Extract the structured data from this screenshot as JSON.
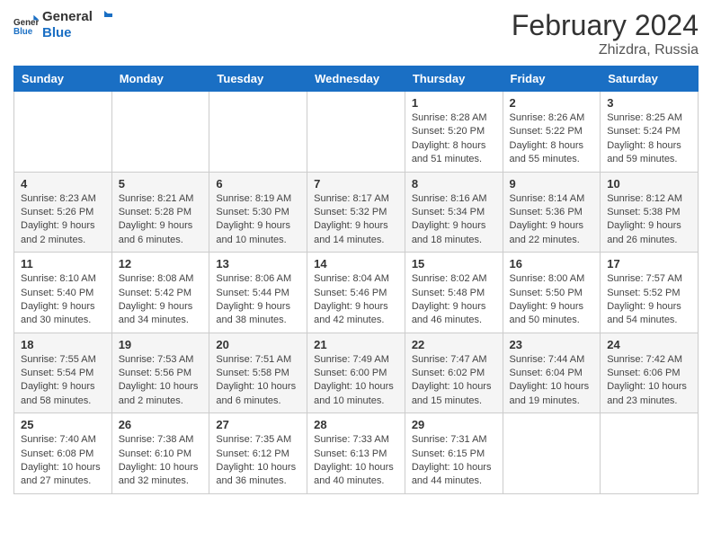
{
  "header": {
    "logo_line1": "General",
    "logo_line2": "Blue",
    "month": "February 2024",
    "location": "Zhizdra, Russia"
  },
  "days_of_week": [
    "Sunday",
    "Monday",
    "Tuesday",
    "Wednesday",
    "Thursday",
    "Friday",
    "Saturday"
  ],
  "weeks": [
    [
      {
        "day": "",
        "info": ""
      },
      {
        "day": "",
        "info": ""
      },
      {
        "day": "",
        "info": ""
      },
      {
        "day": "",
        "info": ""
      },
      {
        "day": "1",
        "info": "Sunrise: 8:28 AM\nSunset: 5:20 PM\nDaylight: 8 hours\nand 51 minutes."
      },
      {
        "day": "2",
        "info": "Sunrise: 8:26 AM\nSunset: 5:22 PM\nDaylight: 8 hours\nand 55 minutes."
      },
      {
        "day": "3",
        "info": "Sunrise: 8:25 AM\nSunset: 5:24 PM\nDaylight: 8 hours\nand 59 minutes."
      }
    ],
    [
      {
        "day": "4",
        "info": "Sunrise: 8:23 AM\nSunset: 5:26 PM\nDaylight: 9 hours\nand 2 minutes."
      },
      {
        "day": "5",
        "info": "Sunrise: 8:21 AM\nSunset: 5:28 PM\nDaylight: 9 hours\nand 6 minutes."
      },
      {
        "day": "6",
        "info": "Sunrise: 8:19 AM\nSunset: 5:30 PM\nDaylight: 9 hours\nand 10 minutes."
      },
      {
        "day": "7",
        "info": "Sunrise: 8:17 AM\nSunset: 5:32 PM\nDaylight: 9 hours\nand 14 minutes."
      },
      {
        "day": "8",
        "info": "Sunrise: 8:16 AM\nSunset: 5:34 PM\nDaylight: 9 hours\nand 18 minutes."
      },
      {
        "day": "9",
        "info": "Sunrise: 8:14 AM\nSunset: 5:36 PM\nDaylight: 9 hours\nand 22 minutes."
      },
      {
        "day": "10",
        "info": "Sunrise: 8:12 AM\nSunset: 5:38 PM\nDaylight: 9 hours\nand 26 minutes."
      }
    ],
    [
      {
        "day": "11",
        "info": "Sunrise: 8:10 AM\nSunset: 5:40 PM\nDaylight: 9 hours\nand 30 minutes."
      },
      {
        "day": "12",
        "info": "Sunrise: 8:08 AM\nSunset: 5:42 PM\nDaylight: 9 hours\nand 34 minutes."
      },
      {
        "day": "13",
        "info": "Sunrise: 8:06 AM\nSunset: 5:44 PM\nDaylight: 9 hours\nand 38 minutes."
      },
      {
        "day": "14",
        "info": "Sunrise: 8:04 AM\nSunset: 5:46 PM\nDaylight: 9 hours\nand 42 minutes."
      },
      {
        "day": "15",
        "info": "Sunrise: 8:02 AM\nSunset: 5:48 PM\nDaylight: 9 hours\nand 46 minutes."
      },
      {
        "day": "16",
        "info": "Sunrise: 8:00 AM\nSunset: 5:50 PM\nDaylight: 9 hours\nand 50 minutes."
      },
      {
        "day": "17",
        "info": "Sunrise: 7:57 AM\nSunset: 5:52 PM\nDaylight: 9 hours\nand 54 minutes."
      }
    ],
    [
      {
        "day": "18",
        "info": "Sunrise: 7:55 AM\nSunset: 5:54 PM\nDaylight: 9 hours\nand 58 minutes."
      },
      {
        "day": "19",
        "info": "Sunrise: 7:53 AM\nSunset: 5:56 PM\nDaylight: 10 hours\nand 2 minutes."
      },
      {
        "day": "20",
        "info": "Sunrise: 7:51 AM\nSunset: 5:58 PM\nDaylight: 10 hours\nand 6 minutes."
      },
      {
        "day": "21",
        "info": "Sunrise: 7:49 AM\nSunset: 6:00 PM\nDaylight: 10 hours\nand 10 minutes."
      },
      {
        "day": "22",
        "info": "Sunrise: 7:47 AM\nSunset: 6:02 PM\nDaylight: 10 hours\nand 15 minutes."
      },
      {
        "day": "23",
        "info": "Sunrise: 7:44 AM\nSunset: 6:04 PM\nDaylight: 10 hours\nand 19 minutes."
      },
      {
        "day": "24",
        "info": "Sunrise: 7:42 AM\nSunset: 6:06 PM\nDaylight: 10 hours\nand 23 minutes."
      }
    ],
    [
      {
        "day": "25",
        "info": "Sunrise: 7:40 AM\nSunset: 6:08 PM\nDaylight: 10 hours\nand 27 minutes."
      },
      {
        "day": "26",
        "info": "Sunrise: 7:38 AM\nSunset: 6:10 PM\nDaylight: 10 hours\nand 32 minutes."
      },
      {
        "day": "27",
        "info": "Sunrise: 7:35 AM\nSunset: 6:12 PM\nDaylight: 10 hours\nand 36 minutes."
      },
      {
        "day": "28",
        "info": "Sunrise: 7:33 AM\nSunset: 6:13 PM\nDaylight: 10 hours\nand 40 minutes."
      },
      {
        "day": "29",
        "info": "Sunrise: 7:31 AM\nSunset: 6:15 PM\nDaylight: 10 hours\nand 44 minutes."
      },
      {
        "day": "",
        "info": ""
      },
      {
        "day": "",
        "info": ""
      }
    ]
  ]
}
